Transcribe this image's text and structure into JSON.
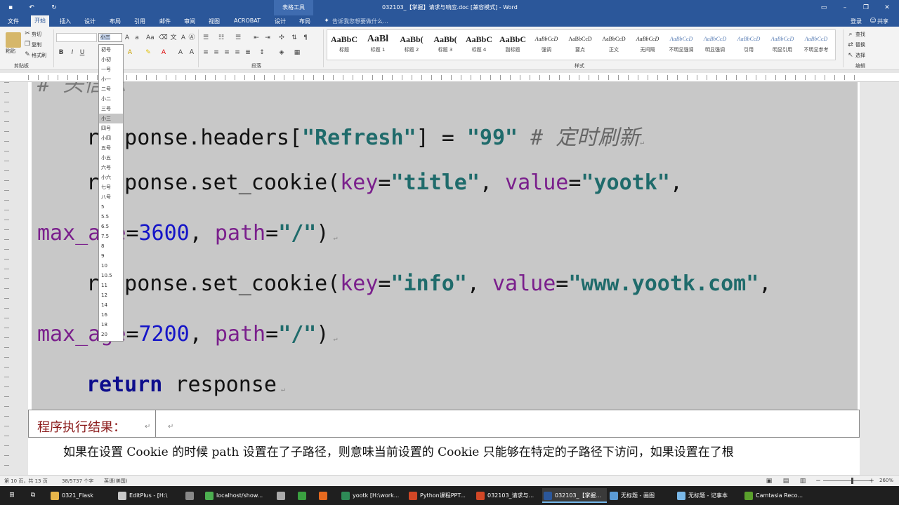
{
  "window": {
    "title": "032103_【掌握】请求与响应.doc [兼容模式] - Word",
    "context_tools": "表格工具",
    "login": "登录",
    "share": "共享"
  },
  "tabs": [
    "文件",
    "开始",
    "插入",
    "设计",
    "布局",
    "引用",
    "邮件",
    "审阅",
    "视图",
    "ACROBAT",
    "设计",
    "布局"
  ],
  "active_tab": "开始",
  "tell_me": "告诉我您想要做什么...",
  "clipboard": {
    "cut": "剪切",
    "copy": "复制",
    "format_painter": "格式刷",
    "paste": "粘贴",
    "label": "剪贴板"
  },
  "font_size_value": "小三",
  "paragraph_label": "段落",
  "styles_label": "样式",
  "editing": {
    "find": "查找",
    "replace": "替换",
    "select": "选择",
    "label": "编辑"
  },
  "styles": [
    {
      "preview": "AaBbC",
      "name": "标题"
    },
    {
      "preview": "AaBl",
      "name": "标题 1"
    },
    {
      "preview": "AaBb(",
      "name": "标题 2"
    },
    {
      "preview": "AaBb(",
      "name": "标题 3"
    },
    {
      "preview": "AaBbC",
      "name": "标题 4"
    },
    {
      "preview": "AaBbC",
      "name": "副标题"
    },
    {
      "preview": "AaBbCcD",
      "name": "强调"
    },
    {
      "preview": "AaBbCcD",
      "name": "要点"
    },
    {
      "preview": "AaBbCcD",
      "name": "正文"
    },
    {
      "preview": "AaBbCcD",
      "name": "无间隔"
    },
    {
      "preview": "AaBbCcD",
      "name": "不明显强调"
    },
    {
      "preview": "AaBbCcD",
      "name": "明显强调"
    },
    {
      "preview": "AaBbCcD",
      "name": "引用"
    },
    {
      "preview": "AaBbCcD",
      "name": "明显引用"
    },
    {
      "preview": "AaBbCcD",
      "name": "不明显参考"
    }
  ],
  "font_size_options": [
    "初号",
    "小初",
    "一号",
    "小一",
    "二号",
    "小二",
    "三号",
    "小三",
    "四号",
    "小四",
    "五号",
    "小五",
    "六号",
    "小六",
    "七号",
    "八号",
    "5",
    "5.5",
    "6.5",
    "7.5",
    "8",
    "9",
    "10",
    "10.5",
    "11",
    "12",
    "14",
    "16",
    "18",
    "20"
  ],
  "code": {
    "top_fragment": "# 头信息",
    "l1_a": "response.headers[",
    "l1_b": "\"Refresh\"",
    "l1_c": "] = ",
    "l1_d": "\"99\"",
    "l1_e": " # 定时刷新",
    "l2_a": "response.set_cookie(",
    "l2_b": "key",
    "l2_c": "=",
    "l2_d": "\"title\"",
    "l2_e": ", ",
    "l2_f": "value",
    "l2_g": "=",
    "l2_h": "\"yootk\"",
    "l2_i": ",",
    "l3_a": "max_age",
    "l3_b": "=",
    "l3_c": "3600",
    "l3_d": ", ",
    "l3_e": "path",
    "l3_f": "=",
    "l3_g": "\"/\"",
    "l3_h": ")",
    "l4_a": "response.set_cookie(",
    "l4_b": "key",
    "l4_c": "=",
    "l4_d": "\"info\"",
    "l4_e": ", ",
    "l4_f": "value",
    "l4_g": "=",
    "l4_h": "\"www.yootk.com\"",
    "l4_i": ",",
    "l5_a": "max_age",
    "l5_b": "=",
    "l5_c": "7200",
    "l5_d": ", ",
    "l5_e": "path",
    "l5_f": "=",
    "l5_g": "\"/\"",
    "l5_h": ")",
    "l6_a": "return",
    "l6_b": " response"
  },
  "result_label": "程序执行结果：",
  "paragraph_text": "如果在设置 Cookie 的时候 path 设置在了子路径，则意味当前设置的 Cookie 只能够在特定的子路径下访问，如果设置在了根",
  "status": {
    "page": "第 10 页，共 13 页",
    "words": "38/5737 个字",
    "lang": "英语(美国)",
    "zoom": "260%"
  },
  "taskbar": [
    {
      "label": "0321_Flask",
      "color": "#e8b64a"
    },
    {
      "label": "EditPlus - [H:\\",
      "color": "#c8c8c8"
    },
    {
      "label": "",
      "color": "#888888"
    },
    {
      "label": "localhost/show...",
      "color": "#4caf50"
    },
    {
      "label": "",
      "color": "#aaaaaa"
    },
    {
      "label": "",
      "color": "#3aa040"
    },
    {
      "label": "",
      "color": "#e66a1f"
    },
    {
      "label": "yootk [H:\\work...",
      "color": "#2e8b57"
    },
    {
      "label": "Python课程PPT...",
      "color": "#d24726"
    },
    {
      "label": "032103_请求与...",
      "color": "#d24726"
    },
    {
      "label": "032103_【掌握...",
      "color": "#2b579a"
    },
    {
      "label": "无标题 - 画图",
      "color": "#5b9bd5"
    },
    {
      "label": "无标题 - 记事本",
      "color": "#7ab8e8"
    },
    {
      "label": "Camtasia Reco...",
      "color": "#5aa02c"
    }
  ]
}
